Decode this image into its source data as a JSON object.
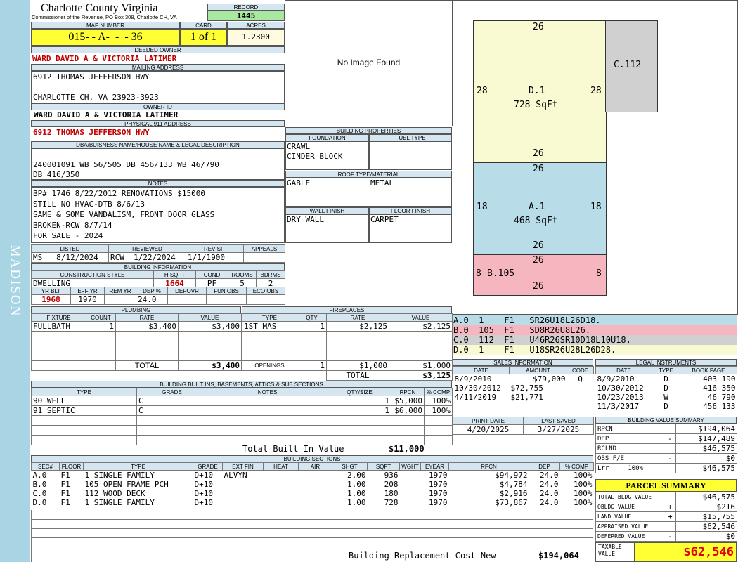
{
  "sidebar": {
    "district": "MADISON"
  },
  "header": {
    "county": "Charlotte County Virginia",
    "commissioner": "Commissioner of the Revenue, PO Box 308, Charlotte CH, VA",
    "record_label": "RECORD",
    "record": "1445",
    "map_label": "MAP NUMBER",
    "map": "015- - A-  -  - 36",
    "card_label": "CARD",
    "card": "1 of 1",
    "acres_label": "ACRES",
    "acres": "1.2300"
  },
  "owner": {
    "deeded_label": "DEEDED OWNER",
    "deeded": "WARD DAVID A & VICTORIA LATIMER",
    "mailing_label": "MAILING ADDRESS",
    "mail1": "6912 THOMAS JEFFERSON HWY",
    "mail2": "CHARLOTTE CH, VA 23923-3923",
    "ownerid_label": "OWNER ID",
    "ownerid": "WARD DAVID A & VICTORIA LATIMER",
    "phys_label": "PHYSICAL 911 ADDRESS",
    "phys": "6912 THOMAS JEFFERSON HWY"
  },
  "legal": {
    "label": "DBA/BUISNESS NAME/HOUSE NAME & LEGAL DESCRIPTION",
    "line1": "240001091 WB 56/505 DB 456/133 WB 46/790",
    "line2": "DB 416/350"
  },
  "notes": {
    "label": "NOTES",
    "lines": [
      "BP# 1746 8/22/2012 RENOVATIONS $15000",
      "STILL NO HVAC-DTB 8/6/13",
      "SAME & SOME VANDALISM, FRONT DOOR GLASS",
      "BROKEN-RCW 8/7/14",
      "FOR SALE - 2024"
    ]
  },
  "review": {
    "listed_label": "LISTED",
    "reviewed_label": "REVIEWED",
    "revisit_label": "REVISIT",
    "appeals_label": "APPEALS",
    "listed": "MS   8/12/2024",
    "reviewed": "RCW  1/22/2024",
    "revisit": "1/1/1900",
    "appeals": ""
  },
  "building_info": {
    "label": "BUILDING INFORMATION",
    "style_label": "CONSTRUCTION STYLE",
    "hsqft_label": "H SQFT",
    "cond_label": "COND",
    "rooms_label": "ROOMS",
    "bdrms_label": "BDRMS",
    "style": "DWELLING",
    "hsqft": "1664",
    "cond": "PF",
    "rooms": "5",
    "bdrms": "2",
    "yrblt_label": "YR BLT",
    "effyr_label": "EFF YR",
    "remyr_label": "REM YR",
    "dep_label": "DEP %",
    "depovr_label": "DEPOVR",
    "funobs_label": "FUN OBS",
    "ecoobs_label": "ECO OBS",
    "yrblt": "1968",
    "effyr": "1970",
    "remyr": "",
    "dep": "24.0",
    "depovr": "",
    "funobs": "",
    "ecoobs": ""
  },
  "photo": {
    "text": "No Image Found"
  },
  "bldg_props": {
    "label": "BUILDING PROPERTIES",
    "foundation_label": "FOUNDATION",
    "fuel_label": "FUEL TYPE",
    "foundation1": "CRAWL",
    "foundation2": "CINDER BLOCK",
    "roof_label": "ROOF TYPE/MATERIAL",
    "roof_type": "GABLE",
    "roof_mat": "METAL",
    "wall_label": "WALL FINISH",
    "floor_label": "FLOOR FINISH",
    "wall": "DRY WALL",
    "floor": "CARPET"
  },
  "plumbing": {
    "label": "PLUMBING",
    "cols": [
      "FIXTURE",
      "COUNT",
      "RATE",
      "VALUE"
    ],
    "rows": [
      [
        "FULLBATH",
        "1",
        "$3,400",
        "$3,400"
      ]
    ],
    "total_label": "TOTAL",
    "total": "$3,400"
  },
  "fireplaces": {
    "label": "FIREPLACES",
    "cols": [
      "TYPE",
      "QTY",
      "RATE",
      "VALUE"
    ],
    "rows": [
      [
        "1ST MAS",
        "1",
        "$2,125",
        "$2,125"
      ]
    ],
    "openings_label": "OPENINGS",
    "openings_qty": "1",
    "openings_rate": "$1,000",
    "openings_value": "$1,000",
    "total_label": "TOTAL",
    "total": "$3,125"
  },
  "builtins": {
    "label": "BUILDING BUILT INS, BASEMENTS, ATTICS & SUB SECTIONS",
    "cols": [
      "TYPE",
      "GRADE",
      "NOTES",
      "QTY/SIZE",
      "RPCN",
      "% COMP"
    ],
    "rows": [
      [
        "90 WELL",
        "C",
        "",
        "1",
        "$5,000",
        "100%"
      ],
      [
        "91 SEPTIC",
        "C",
        "",
        "1",
        "$6,000",
        "100%"
      ]
    ],
    "total_label": "Total Built In Value",
    "total": "$11,000"
  },
  "sketch": {
    "codes": [
      {
        "text": "A.0  1    F1   SR26U18L26D18.",
        "color": "#b8dce8"
      },
      {
        "text": "B.0  105  F1   SD8R26U8L26.",
        "color": "#f6b6c0"
      },
      {
        "text": "C.0  112  F1   U46R26SR10D18L10U18.",
        "color": "#d0d0d0"
      },
      {
        "text": "D.0  1    F1   U18SR26U28L26D28.",
        "color": "#fafad2"
      }
    ],
    "d_label": "D.1",
    "d_sqft": "728 SqFt",
    "a_label": "A.1",
    "a_sqft": "468 SqFt",
    "b_label": "B.105",
    "c_label": "C.112",
    "d_top": "26",
    "d_left": "28",
    "d_right": "28",
    "d_bot": "26",
    "a_top": "26",
    "a_left": "18",
    "a_right": "18",
    "a_bot": "26",
    "b_top": "26",
    "b_left": "8",
    "b_right": "8",
    "b_bot": "26",
    "colors": {
      "d": "#fafad2",
      "a": "#b8dce8",
      "b": "#f6b6c0",
      "c": "#d0d0d0"
    }
  },
  "sales": {
    "label": "SALES INFORMATION",
    "cols": [
      "DATE",
      "AMOUNT",
      "CODE"
    ],
    "rows": [
      [
        "8/9/2010",
        "$79,000",
        "Q"
      ],
      [
        "10/30/2012",
        "$72,755",
        ""
      ],
      [
        "4/11/2019",
        "$21,771",
        ""
      ]
    ]
  },
  "legal_inst": {
    "label": "LEGAL INSTRUMENTS",
    "cols": [
      "DATE",
      "TYPE",
      "BOOK PAGE"
    ],
    "rows": [
      [
        "8/9/2010",
        "D",
        "403 190"
      ],
      [
        "10/30/2012",
        "D",
        "416 350"
      ],
      [
        "10/23/2013",
        "W",
        "46 790"
      ],
      [
        "11/3/2017",
        "D",
        "456 133"
      ]
    ]
  },
  "print": {
    "print_label": "PRINT DATE",
    "saved_label": "LAST SAVED",
    "print_date": "4/20/2025",
    "saved": "3/27/2025"
  },
  "value_summary": {
    "label": "BUILDING VALUE SUMMARY",
    "rows": [
      [
        "RPCN",
        "",
        "$194,064"
      ],
      [
        "DEP",
        "-",
        "$147,489"
      ],
      [
        "RCLND",
        "",
        "$46,575"
      ],
      [
        "OBS F/E",
        "-",
        "$0"
      ],
      [
        "Lrr     100%",
        "",
        "$46,575"
      ]
    ]
  },
  "parcel": {
    "label": "PARCEL SUMMARY",
    "rows": [
      [
        "TOTAL BLDG VALUE",
        "",
        "$46,575"
      ],
      [
        "OBLDG VALUE",
        "+",
        "$216"
      ],
      [
        "LAND VALUE",
        "+",
        "$15,755"
      ],
      [
        "APPRAISED VALUE",
        "",
        "$62,546"
      ],
      [
        "DEFERRED VALUE",
        "-",
        "$0"
      ]
    ],
    "taxable_label1": "TAXABLE",
    "taxable_label2": "VALUE",
    "taxable": "$62,546"
  },
  "sections": {
    "label": "BUILDING SECTIONS",
    "cols": [
      "SEC#",
      "FLOOR",
      "TYPE",
      "GRADE",
      "EXT FIN",
      "HEAT",
      "AIR",
      "SHGT",
      "SQFT",
      "WGHT",
      "EYEAR",
      "RPCN",
      "DEP",
      "% COMP"
    ],
    "rows": [
      [
        "A.0",
        "F1",
        "1 SINGLE FAMILY",
        "D+10",
        "ALVYN",
        "",
        "",
        "2.00",
        "936",
        "",
        "1970",
        "$94,972",
        "24.0",
        "100%"
      ],
      [
        "B.0",
        "F1",
        "105 OPEN FRAME PCH",
        "D+10",
        "",
        "",
        "",
        "1.00",
        "208",
        "",
        "1970",
        "$4,784",
        "24.0",
        "100%"
      ],
      [
        "C.0",
        "F1",
        "112 WOOD DECK",
        "D+10",
        "",
        "",
        "",
        "1.00",
        "180",
        "",
        "1970",
        "$2,916",
        "24.0",
        "100%"
      ],
      [
        "D.0",
        "F1",
        "1 SINGLE FAMILY",
        "D+10",
        "",
        "",
        "",
        "1.00",
        "728",
        "",
        "1970",
        "$73,867",
        "24.0",
        "100%"
      ]
    ],
    "rcn_label": "Building Replacement Cost New",
    "rcn": "$194,064"
  }
}
